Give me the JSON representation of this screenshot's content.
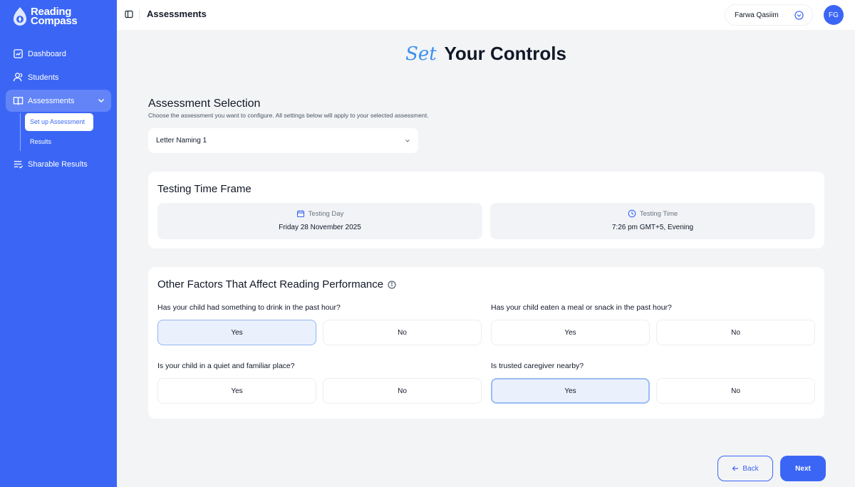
{
  "brand": {
    "line1": "Reading",
    "line2": "Compass"
  },
  "nav": {
    "dashboard": "Dashboard",
    "students": "Students",
    "assessments": "Assessments",
    "setup": "Set up Assessment",
    "results": "Results",
    "sharable": "Sharable Results"
  },
  "header": {
    "title": "Assessments",
    "user_name": "Farwa Qasiim",
    "avatar_initials": "FG"
  },
  "hero": {
    "accent": "Set",
    "rest": "Your Controls"
  },
  "selection": {
    "title": "Assessment Selection",
    "subtitle": "Choose the assessment you want to configure. All settings below will apply to your selected assessment.",
    "selected": "Letter Naming 1"
  },
  "timeframe": {
    "title": "Testing Time Frame",
    "day_label": "Testing Day",
    "day_value": "Friday 28 November 2025",
    "time_label": "Testing Time",
    "time_value": "7:26 pm GMT+5, Evening"
  },
  "factors": {
    "title": "Other Factors That Affect Reading Performance",
    "questions": [
      {
        "text": "Has your child had something to drink in the past hour?",
        "yes": "Yes",
        "no": "No",
        "selected": "yes"
      },
      {
        "text": "Has your child eaten a meal or snack in the past hour?",
        "yes": "Yes",
        "no": "No",
        "selected": ""
      },
      {
        "text": "Is your child in a quiet and familiar place?",
        "yes": "Yes",
        "no": "No",
        "selected": ""
      },
      {
        "text": "Is trusted caregiver nearby?",
        "yes": "Yes",
        "no": "No",
        "selected": "yes"
      }
    ]
  },
  "footer": {
    "back": "Back",
    "next": "Next"
  },
  "colors": {
    "primary": "#3b66f5",
    "accent": "#3b8ff0",
    "selected_bg": "#eaf1fd",
    "page_bg": "#f3f4f6"
  }
}
